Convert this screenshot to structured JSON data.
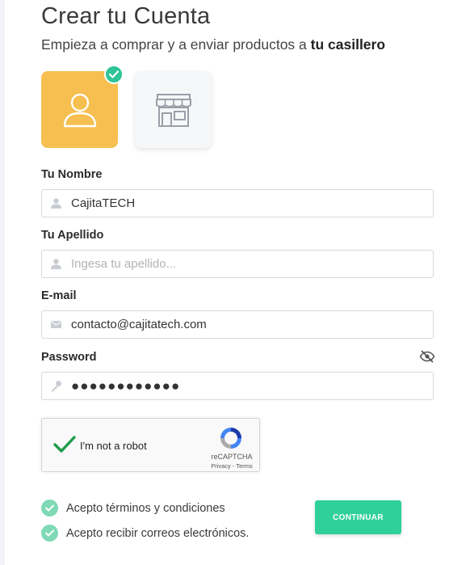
{
  "header": {
    "title": "Crear tu Cuenta",
    "subtitle_prefix": "Empieza a comprar y a enviar productos a ",
    "subtitle_bold": "tu casillero"
  },
  "account_types": [
    {
      "name": "person",
      "icon": "person-icon",
      "selected": true,
      "bg": "#f6bf4f"
    },
    {
      "name": "store",
      "icon": "store-icon",
      "selected": false,
      "bg": "#f6f7f9"
    }
  ],
  "form": {
    "nombre": {
      "label": "Tu Nombre",
      "value": "CajitaTECH",
      "placeholder": ""
    },
    "apellido": {
      "label": "Tu Apellido",
      "value": "",
      "placeholder": "Ingesa tu apellido..."
    },
    "email": {
      "label": "E-mail",
      "value": "contacto@cajitatech.com",
      "placeholder": ""
    },
    "password": {
      "label": "Password",
      "value": "●●●●●●●●●●●●"
    }
  },
  "recaptcha": {
    "label": "I'm not a robot",
    "brand": "reCAPTCHA",
    "links": "Privacy - Terms",
    "checked": true
  },
  "agreements": [
    {
      "label": "Acepto términos y condiciones",
      "checked": true
    },
    {
      "label": "Acepto recibir correos electrónicos.",
      "checked": true
    }
  ],
  "actions": {
    "continue_label": "CONTINUAR"
  },
  "colors": {
    "accent": "#2fd09a",
    "selected_card": "#f6bf4f",
    "check_badge": "#2fc596",
    "agree_check": "#7fd9b6"
  }
}
